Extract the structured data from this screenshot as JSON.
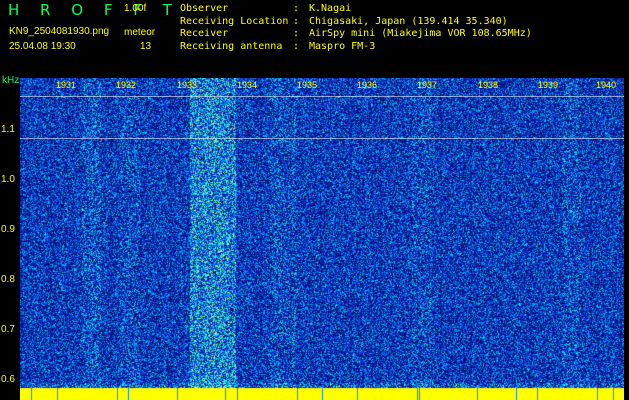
{
  "header": {
    "logo": "H R O F F T",
    "version": "1.00f",
    "filename": "KN9_2504081930.png",
    "meteor_label": "meteor",
    "datetime": "25.04.08 19:30",
    "meteor_count": "13",
    "info": [
      {
        "key": "Observer",
        "value": "K.Nagai"
      },
      {
        "key": "Receiving Location",
        "value": "Chigasaki, Japan (139.414 35.340)"
      },
      {
        "key": "Receiver",
        "value": "AirSpy mini (Miakejima VOR 108.65MHz)"
      },
      {
        "key": "Receiving antenna",
        "value": "Maspro FM-3"
      }
    ]
  },
  "axis": {
    "unit": "kHz",
    "y_ticks": [
      "1.1",
      "1.0",
      "0.9",
      "0.8",
      "0.7",
      "0.6"
    ],
    "x_ticks": [
      "1931",
      "1932",
      "1933",
      "1934",
      "1935",
      "1936",
      "1937",
      "1938",
      "1939",
      "1940"
    ]
  },
  "colors": {
    "background": "#0d2fa0",
    "noise_mid": "#1a3fd0",
    "noise_hi": "#00c8ff",
    "noise_peak": "#7fffb0",
    "strip": "#ffff00"
  }
}
